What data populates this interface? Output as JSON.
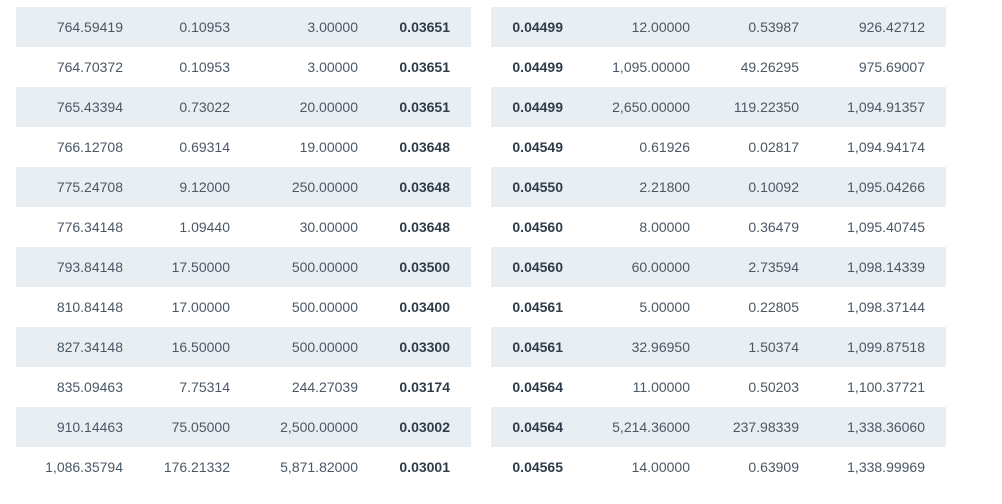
{
  "bids": [
    [
      "764.59419",
      "0.10953",
      "3.00000",
      "0.03651"
    ],
    [
      "764.70372",
      "0.10953",
      "3.00000",
      "0.03651"
    ],
    [
      "765.43394",
      "0.73022",
      "20.00000",
      "0.03651"
    ],
    [
      "766.12708",
      "0.69314",
      "19.00000",
      "0.03648"
    ],
    [
      "775.24708",
      "9.12000",
      "250.00000",
      "0.03648"
    ],
    [
      "776.34148",
      "1.09440",
      "30.00000",
      "0.03648"
    ],
    [
      "793.84148",
      "17.50000",
      "500.00000",
      "0.03500"
    ],
    [
      "810.84148",
      "17.00000",
      "500.00000",
      "0.03400"
    ],
    [
      "827.34148",
      "16.50000",
      "500.00000",
      "0.03300"
    ],
    [
      "835.09463",
      "7.75314",
      "244.27039",
      "0.03174"
    ],
    [
      "910.14463",
      "75.05000",
      "2,500.00000",
      "0.03002"
    ],
    [
      "1,086.35794",
      "176.21332",
      "5,871.82000",
      "0.03001"
    ]
  ],
  "asks": [
    [
      "0.04499",
      "12.00000",
      "0.53987",
      "926.42712"
    ],
    [
      "0.04499",
      "1,095.00000",
      "49.26295",
      "975.69007"
    ],
    [
      "0.04499",
      "2,650.00000",
      "119.22350",
      "1,094.91357"
    ],
    [
      "0.04549",
      "0.61926",
      "0.02817",
      "1,094.94174"
    ],
    [
      "0.04550",
      "2.21800",
      "0.10092",
      "1,095.04266"
    ],
    [
      "0.04560",
      "8.00000",
      "0.36479",
      "1,095.40745"
    ],
    [
      "0.04560",
      "60.00000",
      "2.73594",
      "1,098.14339"
    ],
    [
      "0.04561",
      "5.00000",
      "0.22805",
      "1,098.37144"
    ],
    [
      "0.04561",
      "32.96950",
      "1.50374",
      "1,099.87518"
    ],
    [
      "0.04564",
      "11.00000",
      "0.50203",
      "1,100.37721"
    ],
    [
      "0.04564",
      "5,214.36000",
      "237.98339",
      "1,338.36060"
    ],
    [
      "0.04565",
      "14.00000",
      "0.63909",
      "1,338.99969"
    ]
  ],
  "colors": {
    "stripe": "#e9eef2",
    "text": "#4a5866",
    "price_text": "#2f3d4a"
  }
}
